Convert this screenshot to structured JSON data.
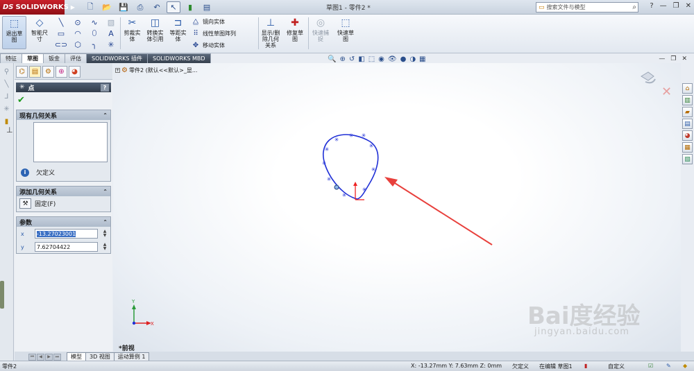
{
  "app": {
    "logo": "SOLIDWORKS",
    "window_title": "草图1 - 零件2 *",
    "search_placeholder": "搜索文件与模型",
    "help": "?"
  },
  "commands": {
    "exit_sketch": "退出草图",
    "smart_dimension": "智能尺寸",
    "trim": "剪裁实体",
    "convert": "转换实体引用",
    "offset": "等距实体",
    "mirror": "镜向实体",
    "linear_pattern": "线性草图阵列",
    "move": "移动实体",
    "display_delete": "显示/删除几何关系",
    "repair": "修复草图",
    "rapid_snaps": "快速捕捉",
    "quick_sketch": "快速草图"
  },
  "tabs": [
    {
      "label": "特征"
    },
    {
      "label": "草图"
    },
    {
      "label": "钣金"
    },
    {
      "label": "评估"
    },
    {
      "label": "SOLIDWORKS 插件"
    },
    {
      "label": "SOLIDWORKS MBD"
    }
  ],
  "property_manager": {
    "title": "点",
    "help": "?",
    "existing_relations": {
      "header": "现有几何关系",
      "status": "欠定义"
    },
    "add_relations": {
      "header": "添加几何关系",
      "fix_label": "固定(F)"
    },
    "parameters": {
      "header": "参数",
      "x_label": "x",
      "y_label": "y",
      "x_value": "-13.27023001",
      "y_value": "7.62704422"
    }
  },
  "graphics": {
    "feature_tree_root": "零件2 (默认<<默认>_显...",
    "view_label": "*前视",
    "axis_x": "X",
    "axis_y": "Y",
    "watermark": "Bai度经验",
    "watermark_url": "jingyan.baidu.com",
    "colors": {
      "curve": "#1f2fd6",
      "arrow": "#e8403c"
    }
  },
  "bottom_tabs": [
    {
      "label": "模型"
    },
    {
      "label": "3D 视图"
    },
    {
      "label": "运动算例 1"
    }
  ],
  "status": {
    "left": "零件2",
    "coords": "X: -13.27mm Y: 7.63mm Z: 0mm",
    "state": "欠定义",
    "editing": "在编辑 草图1",
    "units": "自定义"
  }
}
